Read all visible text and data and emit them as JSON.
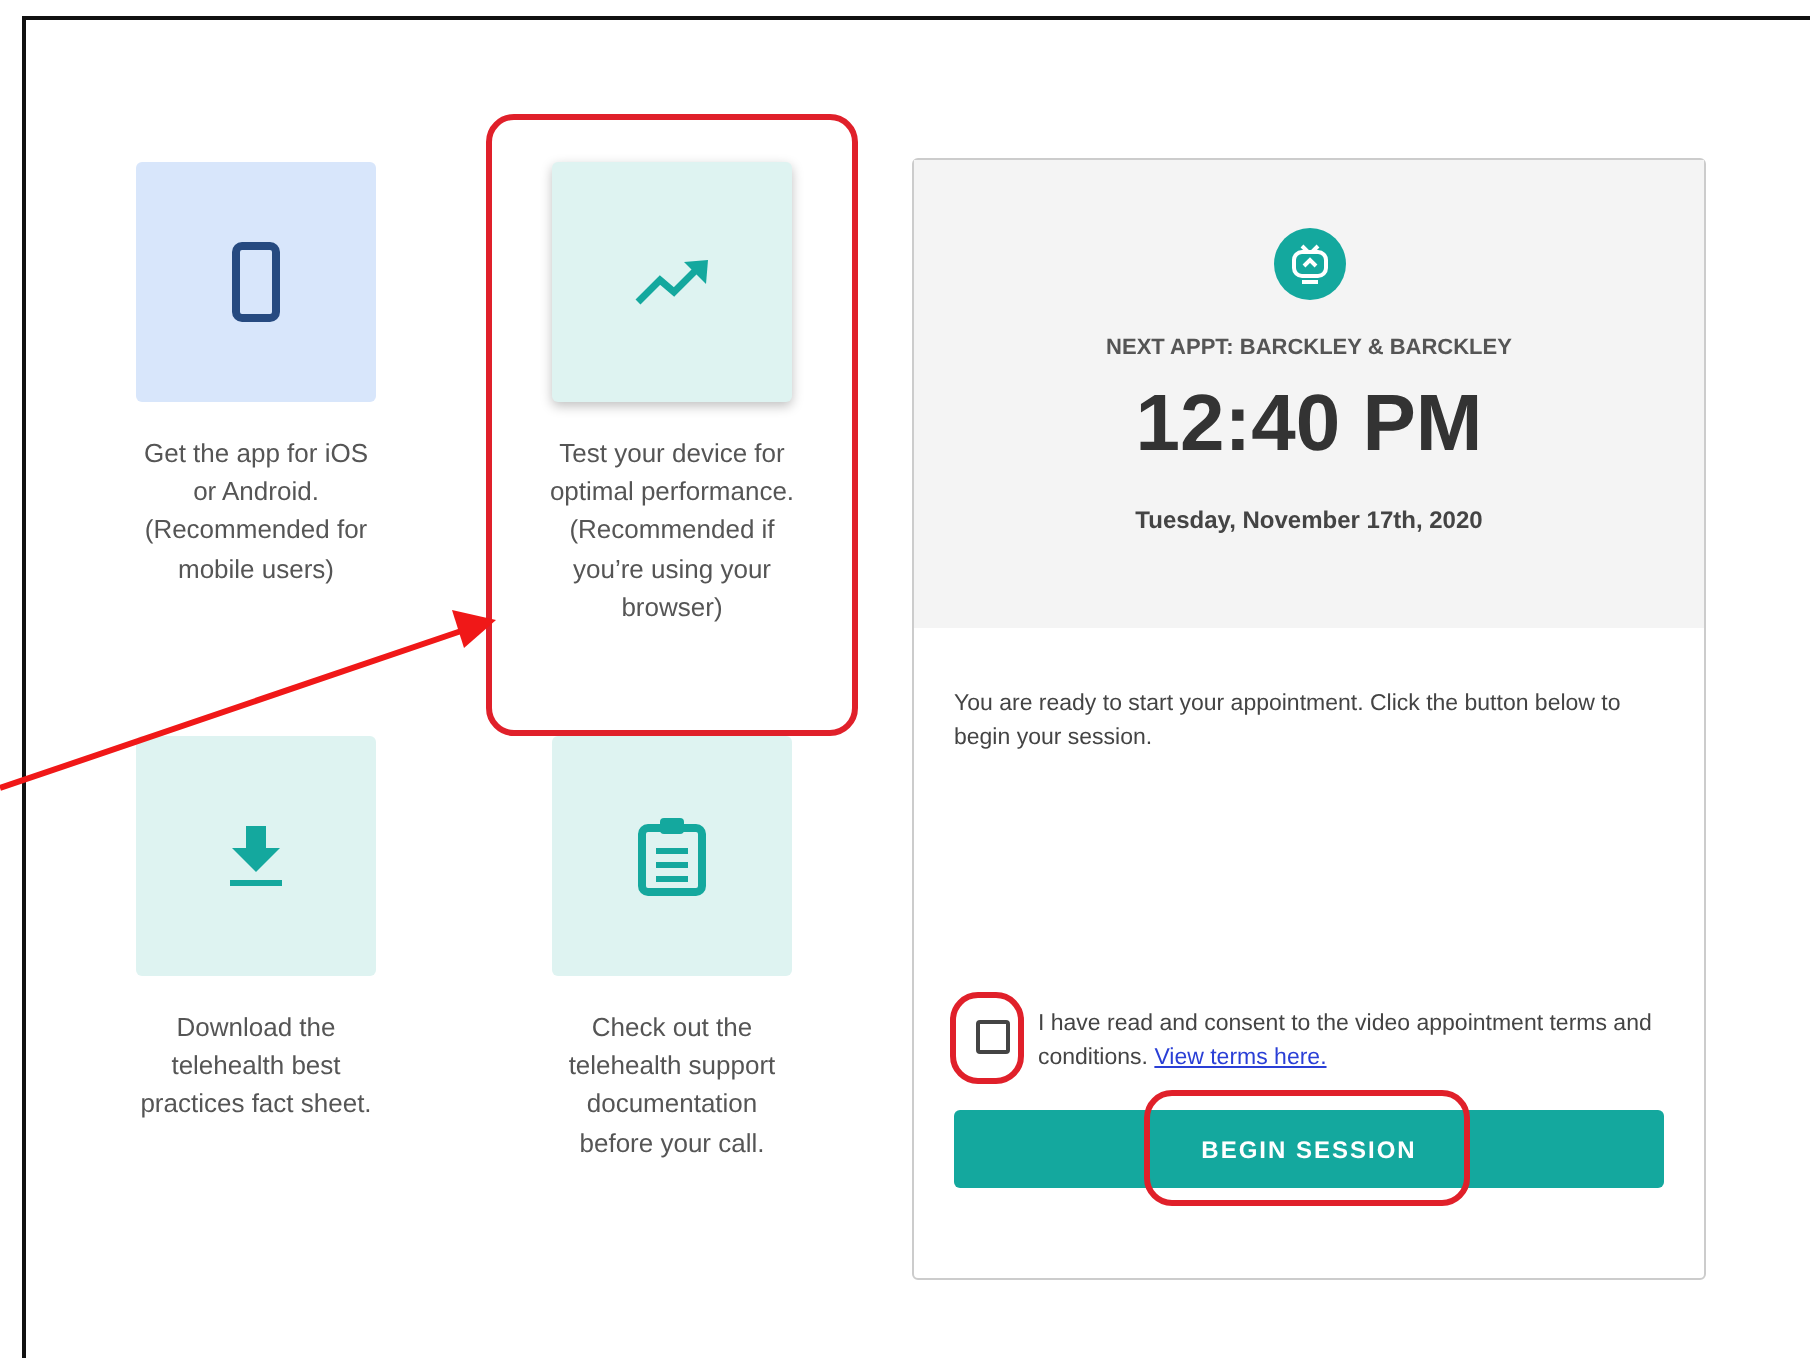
{
  "cards": [
    {
      "kind": "phone",
      "text": "Get the app for iOS or Android. (Recommended for mobile users)",
      "highlighted": false
    },
    {
      "kind": "trend",
      "text": "Test your device for optimal performance. (Recommended if you’re using your browser)",
      "highlighted": true
    },
    {
      "kind": "download",
      "text": "Download the telehealth best practices fact sheet.",
      "highlighted": false
    },
    {
      "kind": "clipboard",
      "text": "Check out the telehealth support documentation before your call.",
      "highlighted": false
    }
  ],
  "appointment": {
    "heading": "NEXT APPT: BARCKLEY & BARCKLEY",
    "time": "12:40 PM",
    "date": "Tuesday, November 17th, 2020",
    "message": "You are ready to start your appointment. Click the button below to begin your session.",
    "consent": {
      "text": "I have read and consent to the video appointment terms and conditions.",
      "link": "View terms here.",
      "checked": false,
      "highlighted": true
    },
    "button": {
      "label": "BEGIN SESSION",
      "highlighted": true
    }
  }
}
